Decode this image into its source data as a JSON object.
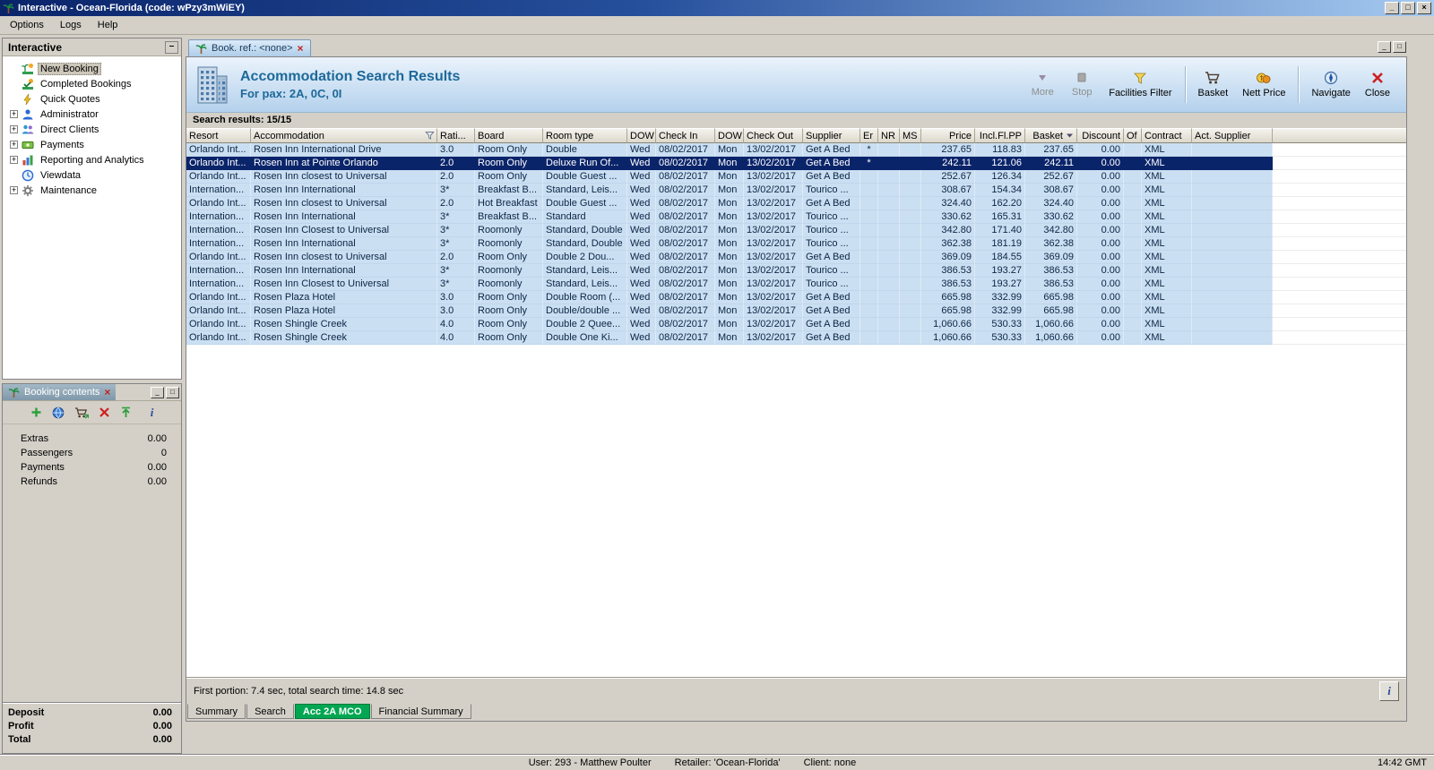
{
  "window": {
    "title": "Interactive - Ocean-Florida (code: wPzy3mWiEY)",
    "menu": [
      "Options",
      "Logs",
      "Help"
    ],
    "status_user": "User: 293 - Matthew Poulter",
    "status_retailer": "Retailer: 'Ocean-Florida'",
    "status_client": "Client: none",
    "time": "14:42 GMT"
  },
  "icons": {
    "minimize": "_",
    "maximize": "□",
    "close": "×",
    "collapse": "–",
    "expand": "+",
    "tab_close": "×",
    "info": "i"
  },
  "sidebar": {
    "title": "Interactive",
    "items": [
      {
        "label": "New Booking",
        "icon": "booking-icon",
        "expand": false,
        "selected": true
      },
      {
        "label": "Completed Bookings",
        "icon": "completed-icon",
        "expand": false
      },
      {
        "label": "Quick Quotes",
        "icon": "quotes-icon",
        "expand": false
      },
      {
        "label": "Administrator",
        "icon": "admin-icon",
        "expand": true
      },
      {
        "label": "Direct Clients",
        "icon": "clients-icon",
        "expand": true
      },
      {
        "label": "Payments",
        "icon": "payments-icon",
        "expand": true
      },
      {
        "label": "Reporting and Analytics",
        "icon": "reports-icon",
        "expand": true
      },
      {
        "label": "Viewdata",
        "icon": "viewdata-icon",
        "expand": false
      },
      {
        "label": "Maintenance",
        "icon": "maintenance-icon",
        "expand": true
      }
    ]
  },
  "booking_contents": {
    "title": "Booking contents",
    "toolbar": [
      "add-icon",
      "globe-icon",
      "basket-export-icon",
      "delete-icon",
      "upload-icon",
      "info-icon"
    ],
    "rows": [
      [
        "Extras",
        "0.00"
      ],
      [
        "Passengers",
        "0"
      ],
      [
        "Payments",
        "0.00"
      ],
      [
        "Refunds",
        "0.00"
      ]
    ],
    "totals": [
      [
        "Deposit",
        "0.00"
      ],
      [
        "Profit",
        "0.00"
      ],
      [
        "Total",
        "0.00"
      ]
    ]
  },
  "main": {
    "tab_label": "Book. ref.: <none>",
    "header_title": "Accommodation Search Results",
    "header_subtitle": "For pax: 2A, 0C, 0I",
    "toolbar": [
      {
        "label": "More",
        "icon": "more-icon",
        "disabled": true
      },
      {
        "label": "Stop",
        "icon": "stop-icon",
        "disabled": true
      },
      {
        "label": "Facilities Filter",
        "icon": "filter-icon"
      },
      {
        "type": "separator"
      },
      {
        "label": "Basket",
        "icon": "basket-icon"
      },
      {
        "label": "Nett Price",
        "icon": "nett-price-icon"
      },
      {
        "type": "separator"
      },
      {
        "label": "Navigate",
        "icon": "navigate-icon"
      },
      {
        "label": "Close",
        "icon": "close-icon"
      }
    ],
    "results_label": "Search results: 15/15",
    "grid": {
      "columns": [
        "Resort",
        "Accommodation",
        "Rati...",
        "Board",
        "Room type",
        "DOW",
        "Check In",
        "DOW",
        "Check Out",
        "Supplier",
        "Er",
        "NR",
        "MS",
        "Price",
        "Incl.Fl.PP",
        "Basket",
        "Discount",
        "Of",
        "Contract",
        "Act. Supplier"
      ],
      "selected_index": 1,
      "rows": [
        [
          "Orlando Int...",
          "Rosen Inn International Drive",
          "3.0",
          "Room Only",
          "Double",
          "Wed",
          "08/02/2017",
          "Mon",
          "13/02/2017",
          "Get A Bed",
          "*",
          "",
          "",
          "237.65",
          "118.83",
          "237.65",
          "0.00",
          "",
          "XML",
          ""
        ],
        [
          "Orlando Int...",
          "Rosen Inn at Pointe Orlando",
          "2.0",
          "Room Only",
          "Deluxe Run Of...",
          "Wed",
          "08/02/2017",
          "Mon",
          "13/02/2017",
          "Get A Bed",
          "*",
          "",
          "",
          "242.11",
          "121.06",
          "242.11",
          "0.00",
          "",
          "XML",
          ""
        ],
        [
          "Orlando Int...",
          "Rosen Inn closest to Universal",
          "2.0",
          "Room Only",
          "Double Guest ...",
          "Wed",
          "08/02/2017",
          "Mon",
          "13/02/2017",
          "Get A Bed",
          "",
          "",
          "",
          "252.67",
          "126.34",
          "252.67",
          "0.00",
          "",
          "XML",
          ""
        ],
        [
          "Internation...",
          "Rosen Inn International",
          "3*",
          "Breakfast B...",
          "Standard, Leis...",
          "Wed",
          "08/02/2017",
          "Mon",
          "13/02/2017",
          "Tourico ...",
          "",
          "",
          "",
          "308.67",
          "154.34",
          "308.67",
          "0.00",
          "",
          "XML",
          ""
        ],
        [
          "Orlando Int...",
          "Rosen Inn closest to Universal",
          "2.0",
          "Hot Breakfast",
          "Double Guest ...",
          "Wed",
          "08/02/2017",
          "Mon",
          "13/02/2017",
          "Get A Bed",
          "",
          "",
          "",
          "324.40",
          "162.20",
          "324.40",
          "0.00",
          "",
          "XML",
          ""
        ],
        [
          "Internation...",
          "Rosen Inn International",
          "3*",
          "Breakfast B...",
          "Standard",
          "Wed",
          "08/02/2017",
          "Mon",
          "13/02/2017",
          "Tourico ...",
          "",
          "",
          "",
          "330.62",
          "165.31",
          "330.62",
          "0.00",
          "",
          "XML",
          ""
        ],
        [
          "Internation...",
          "Rosen Inn Closest to Universal",
          "3*",
          "Roomonly",
          "Standard, Double",
          "Wed",
          "08/02/2017",
          "Mon",
          "13/02/2017",
          "Tourico ...",
          "",
          "",
          "",
          "342.80",
          "171.40",
          "342.80",
          "0.00",
          "",
          "XML",
          ""
        ],
        [
          "Internation...",
          "Rosen Inn International",
          "3*",
          "Roomonly",
          "Standard, Double",
          "Wed",
          "08/02/2017",
          "Mon",
          "13/02/2017",
          "Tourico ...",
          "",
          "",
          "",
          "362.38",
          "181.19",
          "362.38",
          "0.00",
          "",
          "XML",
          ""
        ],
        [
          "Orlando Int...",
          "Rosen Inn closest to Universal",
          "2.0",
          "Room Only",
          "Double 2 Dou...",
          "Wed",
          "08/02/2017",
          "Mon",
          "13/02/2017",
          "Get A Bed",
          "",
          "",
          "",
          "369.09",
          "184.55",
          "369.09",
          "0.00",
          "",
          "XML",
          ""
        ],
        [
          "Internation...",
          "Rosen Inn International",
          "3*",
          "Roomonly",
          "Standard, Leis...",
          "Wed",
          "08/02/2017",
          "Mon",
          "13/02/2017",
          "Tourico ...",
          "",
          "",
          "",
          "386.53",
          "193.27",
          "386.53",
          "0.00",
          "",
          "XML",
          ""
        ],
        [
          "Internation...",
          "Rosen Inn Closest to Universal",
          "3*",
          "Roomonly",
          "Standard, Leis...",
          "Wed",
          "08/02/2017",
          "Mon",
          "13/02/2017",
          "Tourico ...",
          "",
          "",
          "",
          "386.53",
          "193.27",
          "386.53",
          "0.00",
          "",
          "XML",
          ""
        ],
        [
          "Orlando Int...",
          "Rosen Plaza Hotel",
          "3.0",
          "Room Only",
          "Double Room (...",
          "Wed",
          "08/02/2017",
          "Mon",
          "13/02/2017",
          "Get A Bed",
          "",
          "",
          "",
          "665.98",
          "332.99",
          "665.98",
          "0.00",
          "",
          "XML",
          ""
        ],
        [
          "Orlando Int...",
          "Rosen Plaza Hotel",
          "3.0",
          "Room Only",
          "Double/double ...",
          "Wed",
          "08/02/2017",
          "Mon",
          "13/02/2017",
          "Get A Bed",
          "",
          "",
          "",
          "665.98",
          "332.99",
          "665.98",
          "0.00",
          "",
          "XML",
          ""
        ],
        [
          "Orlando Int...",
          "Rosen Shingle Creek",
          "4.0",
          "Room Only",
          "Double 2 Quee...",
          "Wed",
          "08/02/2017",
          "Mon",
          "13/02/2017",
          "Get A Bed",
          "",
          "",
          "",
          "1,060.66",
          "530.33",
          "1,060.66",
          "0.00",
          "",
          "XML",
          ""
        ],
        [
          "Orlando Int...",
          "Rosen Shingle Creek",
          "4.0",
          "Room Only",
          "Double One Ki...",
          "Wed",
          "08/02/2017",
          "Mon",
          "13/02/2017",
          "Get A Bed",
          "",
          "",
          "",
          "1,060.66",
          "530.33",
          "1,060.66",
          "0.00",
          "",
          "XML",
          ""
        ]
      ]
    },
    "footer_status": "First portion: 7.4 sec, total search time: 14.8 sec",
    "bottom_tabs": [
      {
        "label": "Summary"
      },
      {
        "label": "Search"
      },
      {
        "label": "Acc 2A MCO",
        "active": true
      },
      {
        "label": "Financial Summary"
      }
    ]
  }
}
